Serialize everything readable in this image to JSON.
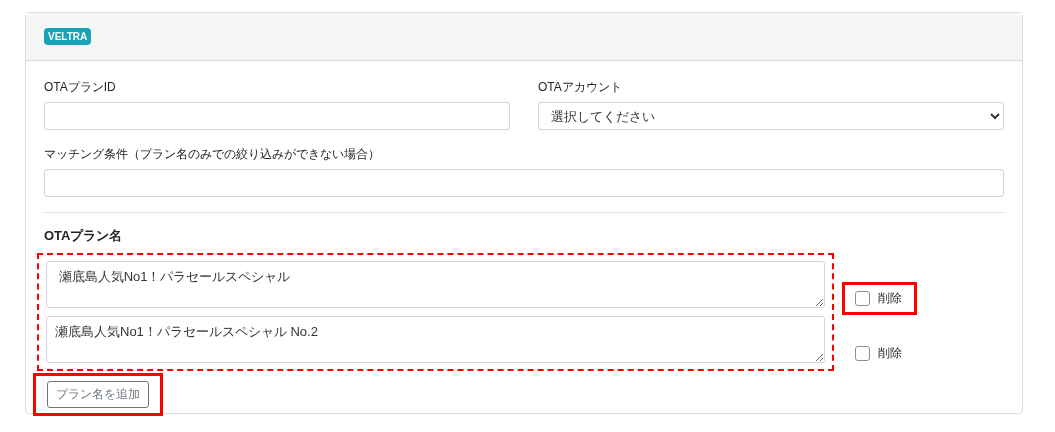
{
  "card": {
    "badge": "VELTRA"
  },
  "fields": [
    {
      "label": "OTAプランID",
      "kind": "input"
    },
    {
      "label": "OTAアカウント",
      "kind": "select",
      "value": "選択してください"
    }
  ],
  "matching": {
    "label": "マッチング条件（プラン名のみでの絞り込みができない場合）"
  },
  "plan_names": {
    "heading": "OTAプラン名",
    "highlighted": true,
    "items": [
      {
        "value": " 瀬底島人気No1！パラセールスペシャル",
        "delete_label": "削除",
        "checked": false,
        "highlighted": true
      },
      {
        "value": "瀬底島人気No1！パラセールスペシャル No.2",
        "delete_label": "削除",
        "checked": false,
        "highlighted": false
      }
    ],
    "add_button": {
      "label": "プラン名を追加",
      "highlighted": true
    }
  }
}
